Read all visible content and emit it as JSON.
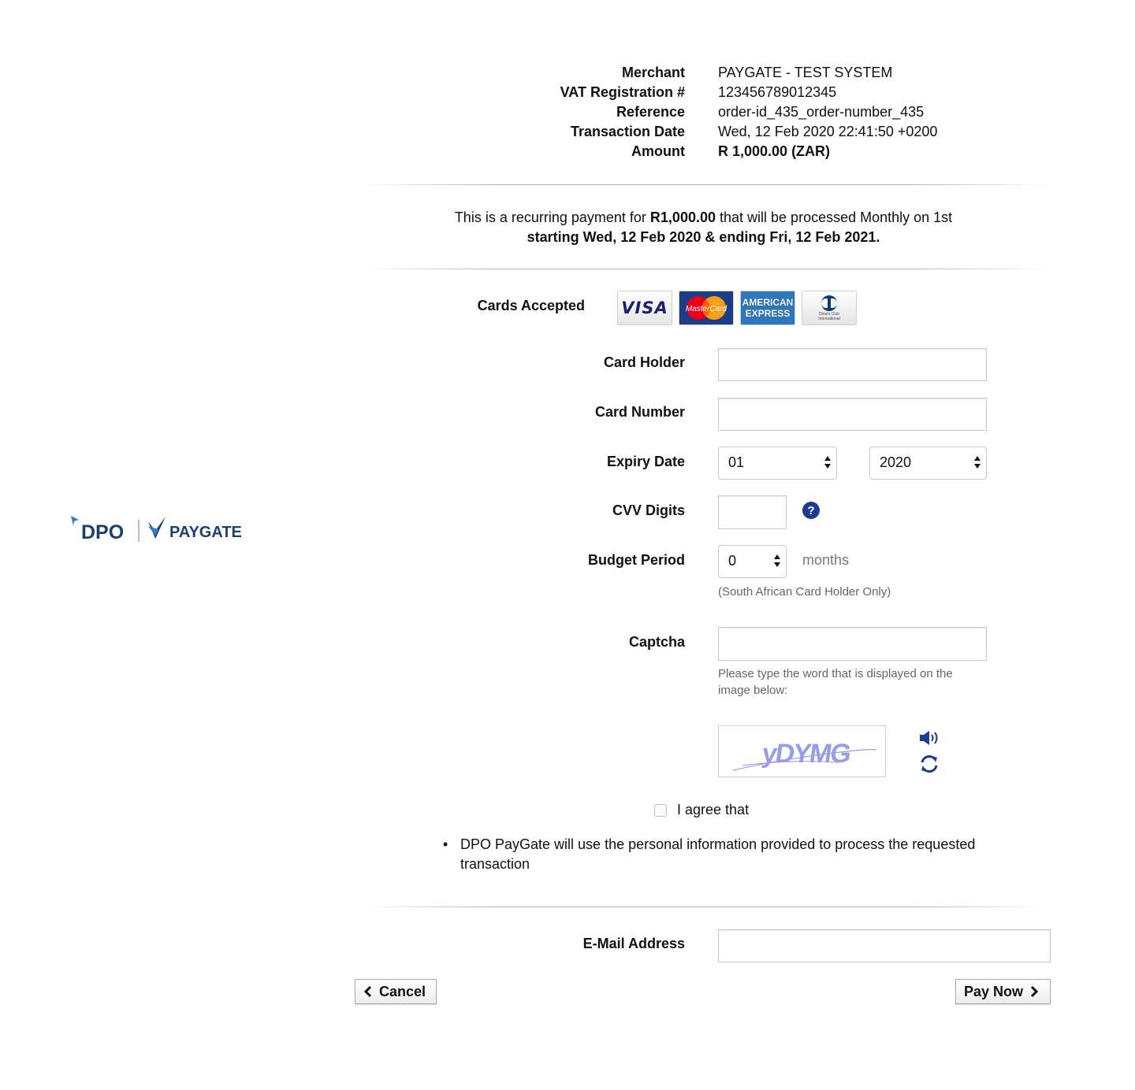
{
  "transaction": {
    "merchant_label": "Merchant",
    "merchant_value": "PAYGATE - TEST SYSTEM",
    "vat_label": "VAT Registration #",
    "vat_value": "123456789012345",
    "reference_label": "Reference",
    "reference_value": "order-id_435_order-number_435",
    "date_label": "Transaction Date",
    "date_value": "Wed, 12 Feb 2020 22:41:50 +0200",
    "amount_label": "Amount",
    "amount_value": "R 1,000.00 (ZAR)"
  },
  "recurring": {
    "prefix": "This is a recurring payment for",
    "amount": "R1,000.00",
    "middle": "that will be processed Monthly on 1st",
    "period": "starting Wed, 12 Feb 2020 & ending Fri, 12 Feb 2021."
  },
  "logo": {
    "brand_left": "DPO",
    "brand_right": "PAYGATE",
    "colors": {
      "dark": "#1b3f73",
      "accent": "#2f80c8"
    }
  },
  "cards": {
    "label": "Cards Accepted",
    "items": [
      {
        "name": "VISA",
        "icon": "visa-card-icon",
        "color": "#1a1f71"
      },
      {
        "name": "MasterCard",
        "icon": "mastercard-card-icon",
        "color": "#eb001b"
      },
      {
        "name_line1": "AMERICAN",
        "name_line2": "EXPRESS",
        "icon": "amex-card-icon",
        "color": "#2e77bb"
      },
      {
        "name": "Diners Club International",
        "icon": "diners-card-icon",
        "color": "#0079be"
      }
    ]
  },
  "form": {
    "card_holder_label": "Card Holder",
    "card_holder_value": "",
    "card_number_label": "Card Number",
    "card_number_value": "",
    "expiry_label": "Expiry Date",
    "expiry_month": "01",
    "expiry_year": "2020",
    "cvv_label": "CVV Digits",
    "cvv_value": "",
    "budget_label": "Budget Period",
    "budget_value": "0",
    "budget_unit": "months",
    "budget_note": "(South African Card Holder Only)",
    "captcha_label": "Captcha",
    "captcha_value": "",
    "captcha_hint": "Please type the word that is displayed on the image below:",
    "captcha_text": "yDYMG",
    "agree_label": "I agree that",
    "agree_checked": false,
    "consent_item": "DPO PayGate will use the personal information provided to process the requested transaction",
    "email_label": "E-Mail Address",
    "email_value": ""
  },
  "actions": {
    "cancel_label": "Cancel",
    "pay_label": "Pay Now"
  },
  "colors": {
    "help_icon": "#1f3a93",
    "captcha_text": "#9a9ce8",
    "icon_blue": "#1f3a93"
  }
}
